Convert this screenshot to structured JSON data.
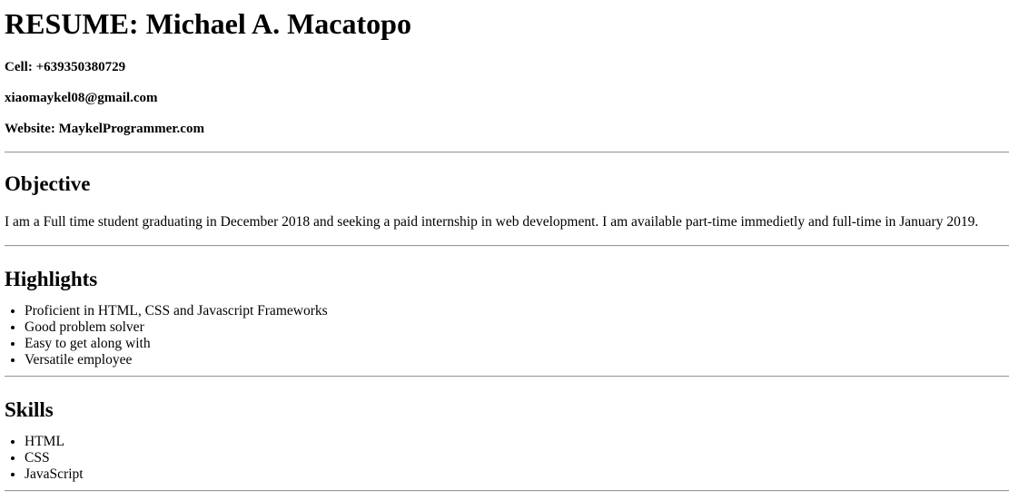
{
  "header": {
    "title": "RESUME: Michael A. Macatopo",
    "cell": "Cell: +639350380729",
    "email": "xiaomaykel08@gmail.com",
    "website": "Website: MaykelProgrammer.com"
  },
  "objective": {
    "heading": "Objective",
    "text": "I am a Full time student graduating in December 2018 and seeking a paid internship in web development. I am available part-time immedietly and full-time in January 2019."
  },
  "highlights": {
    "heading": "Highlights",
    "items": [
      "Proficient in HTML, CSS and Javascript Frameworks",
      "Good problem solver",
      "Easy to get along with",
      "Versatile employee"
    ]
  },
  "skills": {
    "heading": "Skills",
    "items": [
      "HTML",
      "CSS",
      "JavaScript"
    ]
  }
}
